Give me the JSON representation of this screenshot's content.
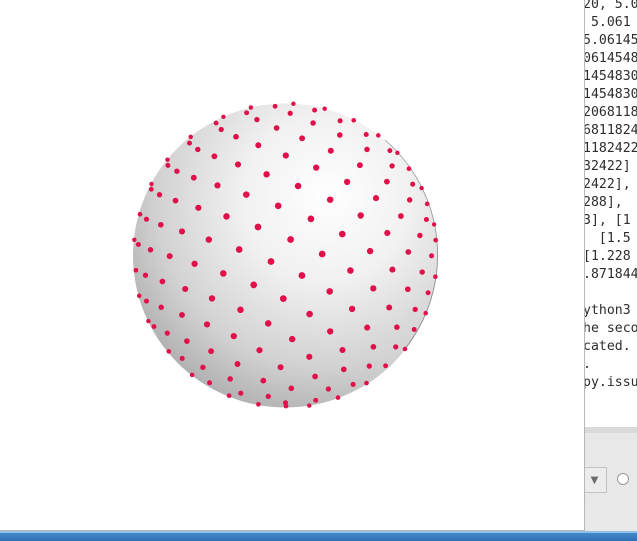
{
  "terminal": {
    "lines": [
      "20, 5.0",
      " 5.061",
      "5.06145",
      "0614548",
      "1454830",
      "1454830",
      "2068118",
      "6811824",
      "1182422",
      "32422]",
      "2422],",
      "288],",
      "3], [1",
      "  [1.5",
      "[1.228",
      ".871844",
      "",
      "ython3",
      "he seco",
      "cated.",
      ".",
      "py.issu"
    ]
  },
  "plot": {
    "sphere_color": "#dcdcdc",
    "point_color": "#e0104a"
  }
}
